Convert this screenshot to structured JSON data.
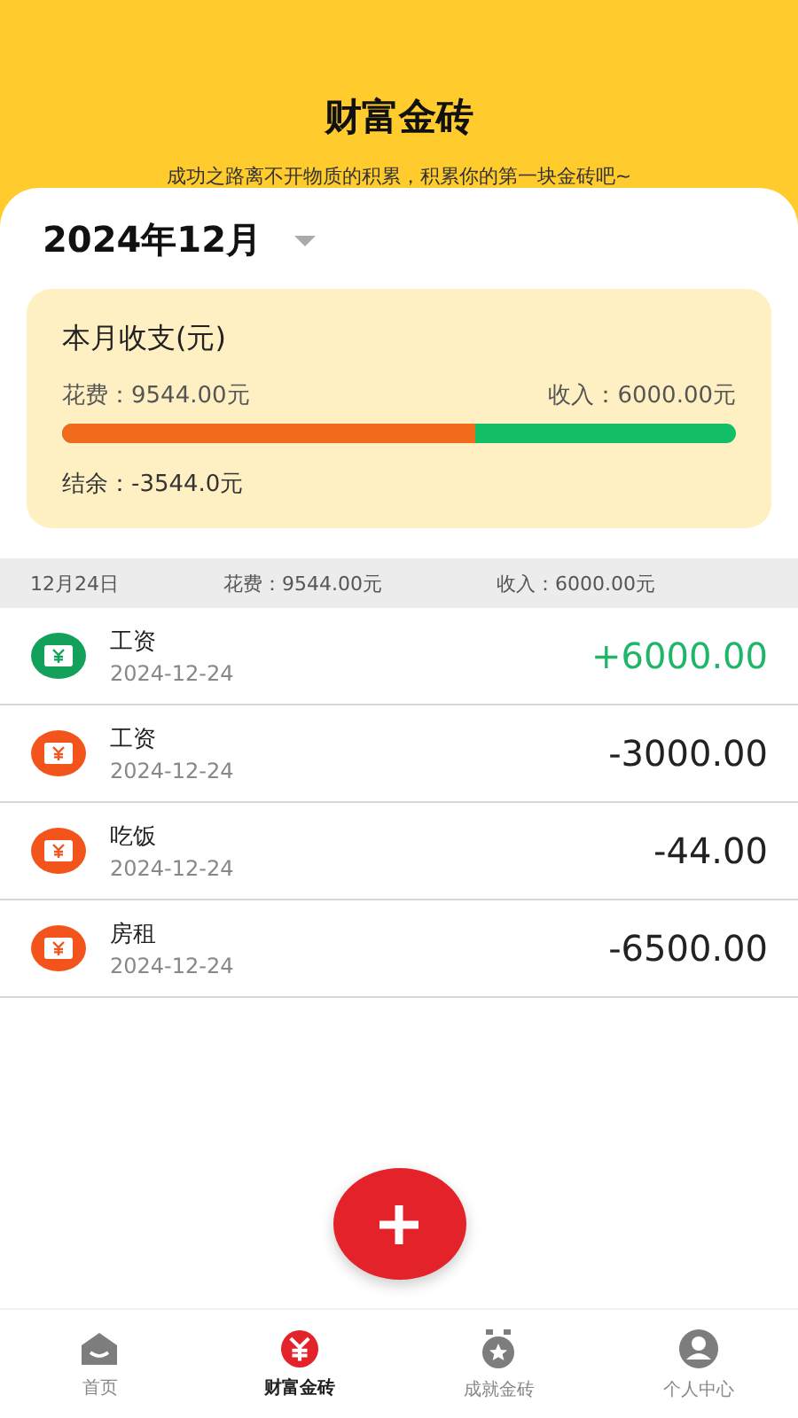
{
  "header": {
    "title": "财富金砖",
    "subtitle": "成功之路离不开物质的积累，积累你的第一块金砖吧~"
  },
  "month": {
    "label": "2024年12月"
  },
  "summary": {
    "title": "本月收支(元)",
    "expense": "花费：9544.00元",
    "income": "收入：6000.00元",
    "level": 0.614,
    "balance": "结余：-3544.0元"
  },
  "day": {
    "date": "12月24日",
    "expense": "花费：9544.00元",
    "income": "收入：6000.00元"
  },
  "records": [
    {
      "kind": "income",
      "name": "工资",
      "date": "2024-12-24",
      "amount": "+6000.00"
    },
    {
      "kind": "expense",
      "name": "工资",
      "date": "2024-12-24",
      "amount": "-3000.00"
    },
    {
      "kind": "expense",
      "name": "吃饭",
      "date": "2024-12-24",
      "amount": "-44.00"
    },
    {
      "kind": "expense",
      "name": "房租",
      "date": "2024-12-24",
      "amount": "-6500.00"
    }
  ],
  "tabs": [
    {
      "kind": "home",
      "label": "首页",
      "selected": false
    },
    {
      "kind": "money",
      "label": "财富金砖",
      "selected": true
    },
    {
      "kind": "medal",
      "label": "成就金砖",
      "selected": false
    },
    {
      "kind": "person",
      "label": "个人中心",
      "selected": false
    }
  ]
}
